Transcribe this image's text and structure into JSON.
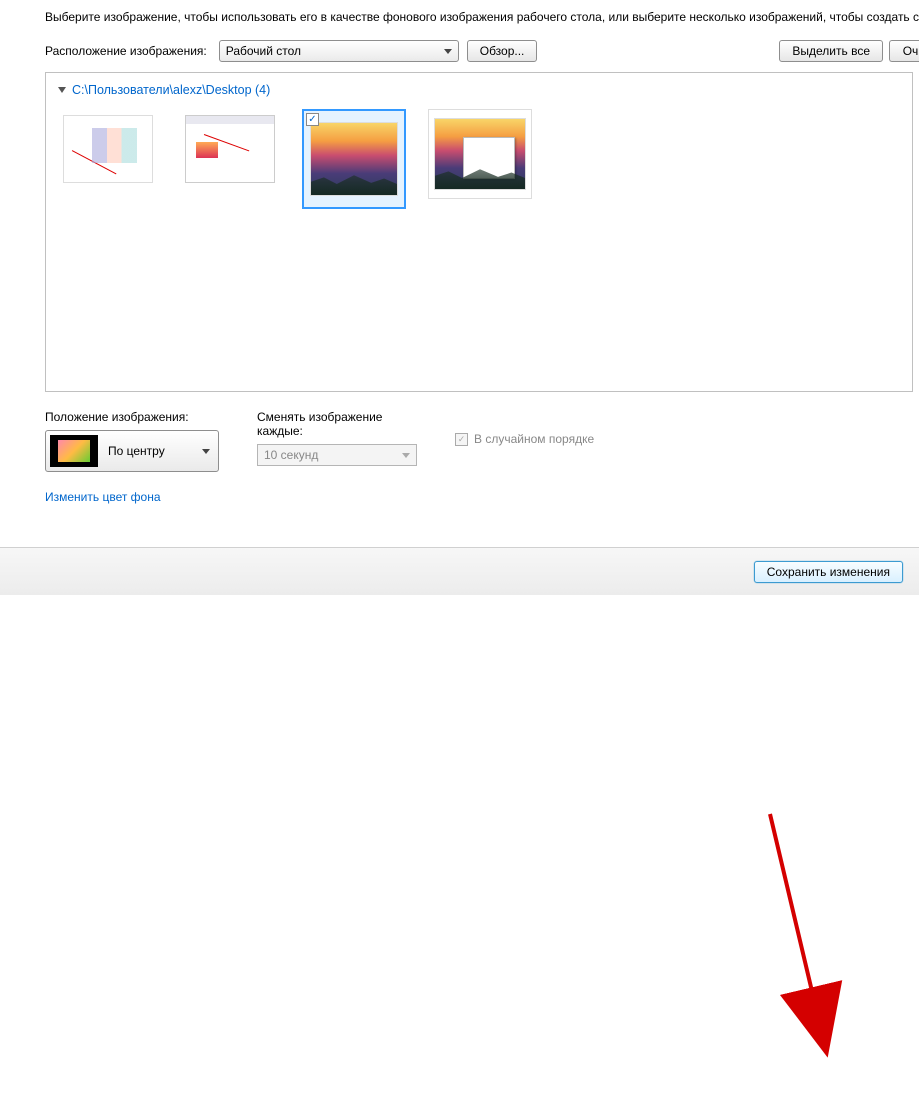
{
  "instruction": "Выберите изображение, чтобы использовать его в качестве фонового изображения рабочего стола, или выберите несколько изображений, чтобы создать сл",
  "location": {
    "label": "Расположение изображения:",
    "value": "Рабочий стол",
    "browse": "Обзор...",
    "select_all": "Выделить все",
    "clear": "Оч"
  },
  "gallery": {
    "path": "C:\\Пользователи\\alexz\\Desktop (4)",
    "items": [
      {
        "checked": false
      },
      {
        "checked": false
      },
      {
        "checked": true
      },
      {
        "checked": false
      }
    ]
  },
  "position": {
    "label": "Положение изображения:",
    "value": "По центру"
  },
  "interval": {
    "label": "Сменять изображение каждые:",
    "value": "10 секунд"
  },
  "shuffle": {
    "label": "В случайном порядке",
    "checked": true
  },
  "change_color": "Изменить цвет фона",
  "footer": {
    "save": "Сохранить изменения"
  }
}
